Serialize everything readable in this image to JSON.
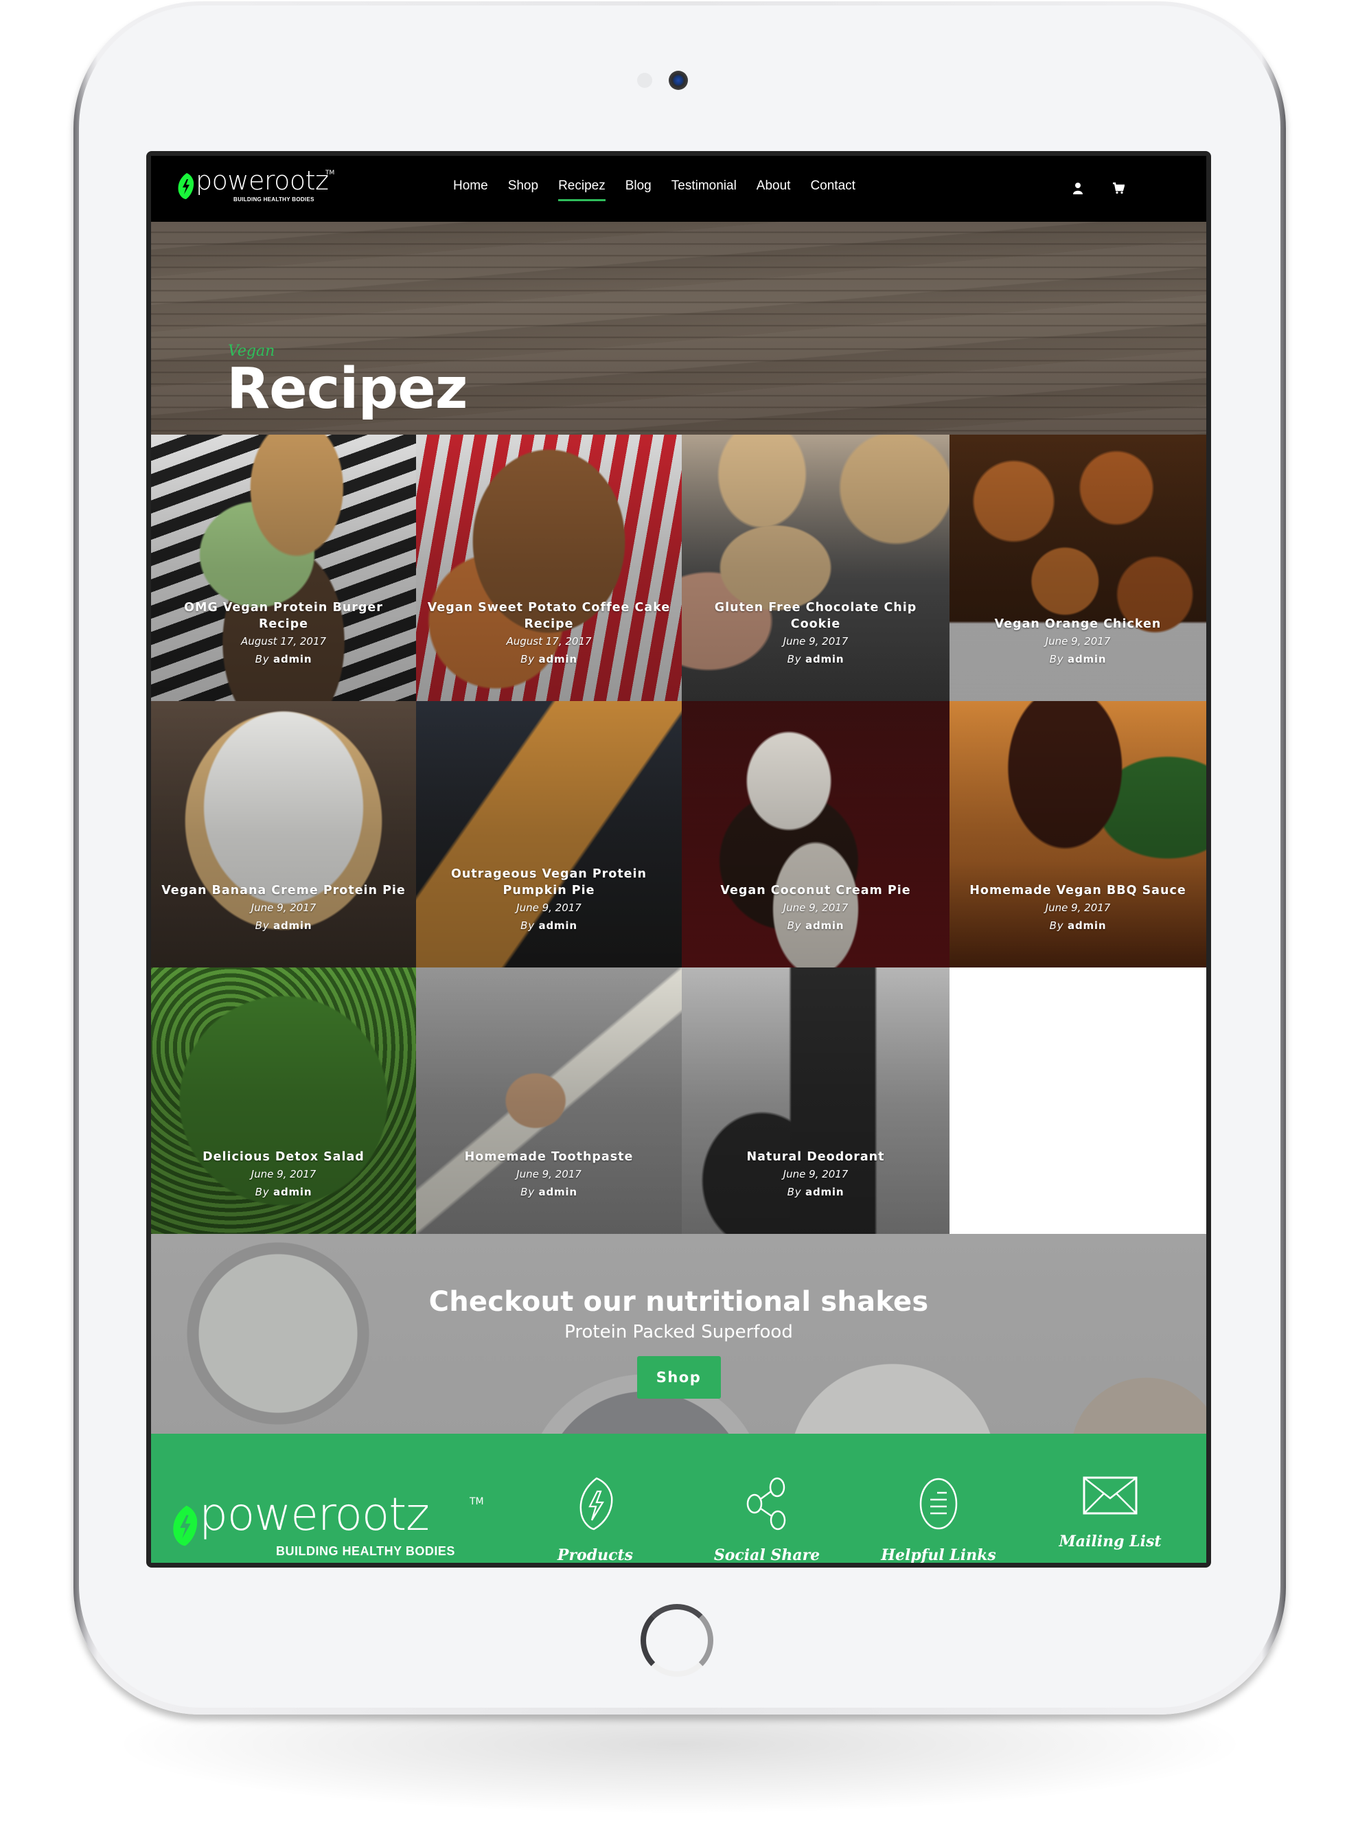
{
  "brand": {
    "name": "powerootz",
    "trademark": "TM",
    "tagline": "BUILDING HEALTHY BODIES",
    "accent_color": "#2fae5e",
    "leaf_color": "#19f53a"
  },
  "nav": {
    "items": [
      {
        "label": "Home",
        "active": false
      },
      {
        "label": "Shop",
        "active": false
      },
      {
        "label": "Recipez",
        "active": true
      },
      {
        "label": "Blog",
        "active": false
      },
      {
        "label": "Testimonial",
        "active": false
      },
      {
        "label": "About",
        "active": false
      },
      {
        "label": "Contact",
        "active": false
      }
    ],
    "icons": [
      "user-icon",
      "cart-icon"
    ]
  },
  "hero": {
    "kicker": "Vegan",
    "title": "Recipez"
  },
  "recipes": [
    {
      "title": "OMG Vegan Protein Burger Recipe",
      "date": "August 17, 2017",
      "by": "By",
      "author": "admin",
      "tone": "burger"
    },
    {
      "title": "Vegan Sweet Potato Coffee Cake Recipe",
      "date": "August 17, 2017",
      "by": "By",
      "author": "admin",
      "tone": "coffeecake"
    },
    {
      "title": "Gluten Free Chocolate Chip Cookie",
      "date": "June 9, 2017",
      "by": "By",
      "author": "admin",
      "tone": "cookie"
    },
    {
      "title": "Vegan Orange Chicken",
      "date": "June 9, 2017",
      "by": "By",
      "author": "admin",
      "tone": "orangechicken"
    },
    {
      "title": "Vegan Banana Creme Protein Pie",
      "date": "June 9, 2017",
      "by": "By",
      "author": "admin",
      "tone": "bananapie"
    },
    {
      "title": "Outrageous Vegan Protein Pumpkin Pie",
      "date": "June 9, 2017",
      "by": "By",
      "author": "admin",
      "tone": "pumpkinpie"
    },
    {
      "title": "Vegan Coconut Cream Pie",
      "date": "June 9, 2017",
      "by": "By",
      "author": "admin",
      "tone": "coconutpie"
    },
    {
      "title": "Homemade Vegan BBQ Sauce",
      "date": "June 9, 2017",
      "by": "By",
      "author": "admin",
      "tone": "bbq"
    },
    {
      "title": "Delicious Detox Salad",
      "date": "June 9, 2017",
      "by": "By",
      "author": "admin",
      "tone": "salad"
    },
    {
      "title": "Homemade Toothpaste",
      "date": "June 9, 2017",
      "by": "By",
      "author": "admin",
      "tone": "toothpaste"
    },
    {
      "title": "Natural Deodorant",
      "date": "June 9, 2017",
      "by": "By",
      "author": "admin",
      "tone": "deodorant"
    }
  ],
  "cta": {
    "title": "Checkout our nutritional shakes",
    "subtitle": "Protein Packed Superfood",
    "button": "Shop"
  },
  "footer": {
    "columns": [
      {
        "icon": "leaf-bolt-icon",
        "label": "Products"
      },
      {
        "icon": "share-icon",
        "label": "Social Share"
      },
      {
        "icon": "list-circle-icon",
        "label": "Helpful Links"
      },
      {
        "icon": "envelope-icon",
        "label": "Mailing List"
      }
    ]
  }
}
